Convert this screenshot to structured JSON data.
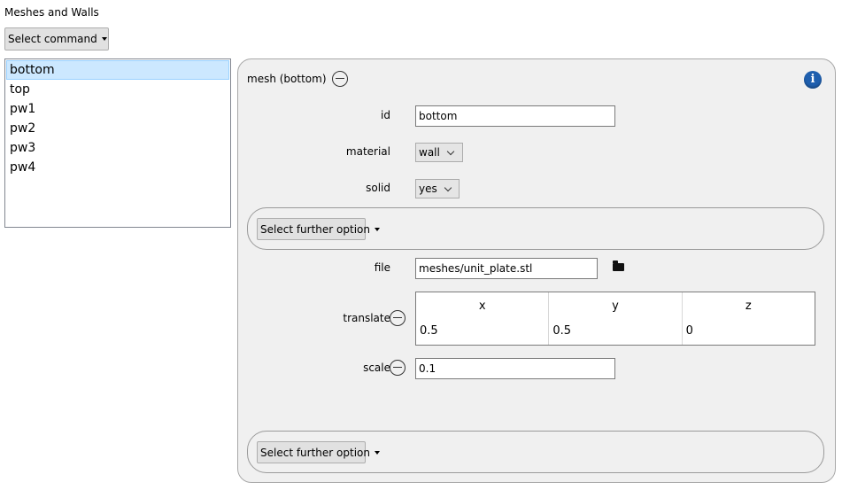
{
  "section_title": "Meshes and Walls",
  "select_command_label": "Select command",
  "list": {
    "items": [
      "bottom",
      "top",
      "pw1",
      "pw2",
      "pw3",
      "pw4"
    ],
    "selected": "bottom"
  },
  "panel": {
    "title": "mesh (bottom)",
    "info_icon": "info-icon",
    "fields": {
      "id": {
        "label": "id",
        "value": "bottom"
      },
      "material": {
        "label": "material",
        "value": "wall"
      },
      "solid": {
        "label": "solid",
        "value": "yes"
      },
      "file": {
        "label": "file",
        "value": "meshes/unit_plate.stl",
        "icon": "folder-icon"
      },
      "translate": {
        "label": "translate",
        "columns": [
          "x",
          "y",
          "z"
        ],
        "values": [
          "0.5",
          "0.5",
          "0"
        ]
      },
      "scale": {
        "label": "scale",
        "value": "0.1"
      }
    },
    "further_option_label": "Select further option"
  },
  "colors": {
    "selection_bg": "#cce8ff",
    "panel_bg": "#f0f0f0",
    "info_icon": "#1f5fae"
  }
}
